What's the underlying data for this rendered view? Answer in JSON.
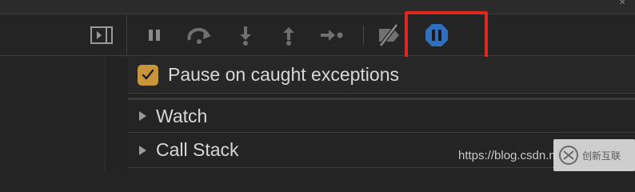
{
  "toolbar": {
    "icons": [
      "sidebar-toggle-icon",
      "pause-icon",
      "step-over-icon",
      "step-into-icon",
      "step-out-icon",
      "step-icon",
      "deactivate-breakpoints-icon",
      "pause-on-exceptions-icon"
    ],
    "highlight_color": "#e0261f",
    "active_icon_color": "#2e6fbf"
  },
  "pause_on_caught": {
    "label": "Pause on caught exceptions",
    "checked": true,
    "checkbox_color": "#c9953a"
  },
  "sections": {
    "watch": "Watch",
    "call_stack": "Call Stack"
  },
  "watermark": {
    "url_text": "https://blog.csdn.n",
    "logo_text": "创新互联"
  }
}
